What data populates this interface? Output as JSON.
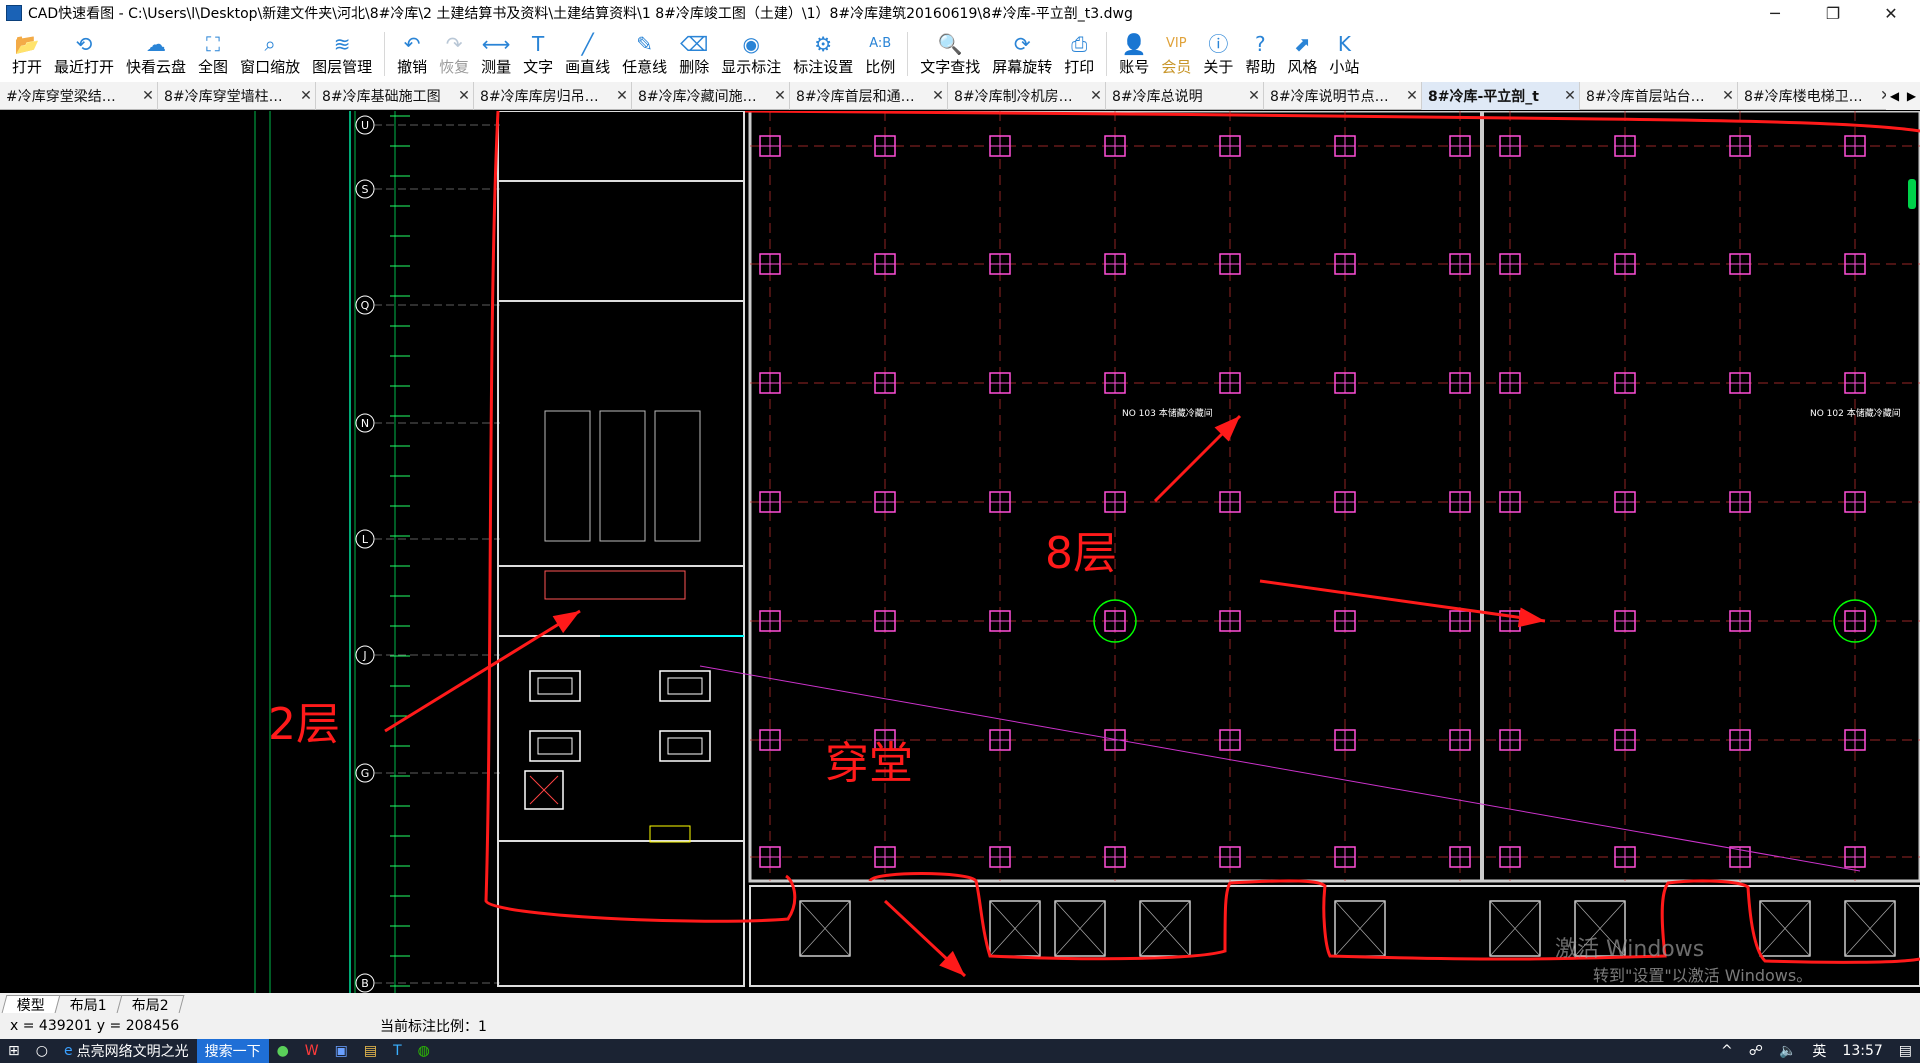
{
  "window": {
    "title": "CAD快速看图 - C:\\Users\\l\\Desktop\\新建文件夹\\河北\\8#冷库\\2  土建结算书及资料\\土建结算资料\\1  8#冷库竣工图（土建）\\1）8#冷库建筑20160619\\8#冷库-平立剖_t3.dwg"
  },
  "toolbar": [
    {
      "label": "打开",
      "icon": "folder-icon",
      "glyph": "📂"
    },
    {
      "label": "最近打开",
      "icon": "history-icon",
      "glyph": "⟲"
    },
    {
      "label": "快看云盘",
      "icon": "cloud-icon",
      "glyph": "☁"
    },
    {
      "label": "全图",
      "icon": "fullview-icon",
      "glyph": "⛶"
    },
    {
      "label": "窗口缩放",
      "icon": "zoom-window-icon",
      "glyph": "⌕"
    },
    {
      "label": "图层管理",
      "icon": "layers-icon",
      "glyph": "≋"
    },
    {
      "label": "撤销",
      "icon": "undo-icon",
      "glyph": "↶"
    },
    {
      "label": "恢复",
      "icon": "redo-icon",
      "glyph": "↷"
    },
    {
      "label": "测量",
      "icon": "measure-icon",
      "glyph": "⟷"
    },
    {
      "label": "文字",
      "icon": "text-icon",
      "glyph": "T"
    },
    {
      "label": "画直线",
      "icon": "line-icon",
      "glyph": "╱"
    },
    {
      "label": "任意线",
      "icon": "pen-icon",
      "glyph": "✎"
    },
    {
      "label": "删除",
      "icon": "eraser-icon",
      "glyph": "⌫"
    },
    {
      "label": "显示标注",
      "icon": "eye-icon",
      "glyph": "◉"
    },
    {
      "label": "标注设置",
      "icon": "settings-icon",
      "glyph": "⚙"
    },
    {
      "label": "比例",
      "icon": "scale-icon",
      "glyph": "A:B"
    },
    {
      "label": "文字查找",
      "icon": "text-search-icon",
      "glyph": "🔍"
    },
    {
      "label": "屏幕旋转",
      "icon": "rotate-icon",
      "glyph": "⟳"
    },
    {
      "label": "打印",
      "icon": "print-icon",
      "glyph": "⎙"
    },
    {
      "label": "账号",
      "icon": "user-icon",
      "glyph": "👤"
    },
    {
      "label": "会员",
      "icon": "vip-icon",
      "glyph": "VIP"
    },
    {
      "label": "关于",
      "icon": "info-icon",
      "glyph": "ⓘ"
    },
    {
      "label": "帮助",
      "icon": "help-icon",
      "glyph": "?"
    },
    {
      "label": "风格",
      "icon": "style-icon",
      "glyph": "⬈"
    },
    {
      "label": "小站",
      "icon": "kstation-icon",
      "glyph": "K"
    }
  ],
  "tabs": [
    {
      "label": "#冷库穿堂梁结…"
    },
    {
      "label": "8#冷库穿堂墙柱…"
    },
    {
      "label": "8#冷库基础施工图"
    },
    {
      "label": "8#冷库库房归吊…"
    },
    {
      "label": "8#冷库冷藏间施…"
    },
    {
      "label": "8#冷库首层和通…"
    },
    {
      "label": "8#冷库制冷机房…"
    },
    {
      "label": "8#冷库总说明"
    },
    {
      "label": "8#冷库说明节点…"
    },
    {
      "label": "8#冷库-平立剖_t"
    },
    {
      "label": "8#冷库首层站台…"
    },
    {
      "label": "8#冷库楼电梯卫…"
    }
  ],
  "active_tab": 9,
  "canvas": {
    "axis_labels": [
      "U",
      "S",
      "Q",
      "N",
      "L",
      "J",
      "G",
      "B"
    ],
    "annotations": {
      "floor8": "8层",
      "floor2": "2层",
      "corridor": "穿堂"
    },
    "room_tags": [
      "NO 103  本储藏冷藏间",
      "NO 102  本储藏冷藏间"
    ],
    "watermark_line1": "激活 Windows",
    "watermark_line2": "转到\"设置\"以激活 Windows。"
  },
  "layout_tabs": [
    "模型",
    "布局1",
    "布局2"
  ],
  "status": {
    "coords": "x = 439201  y = 208456",
    "scale": "当前标注比例：1"
  },
  "taskbar": {
    "browser_item": "点亮网络文明之光",
    "search_item": "搜索一下",
    "ime": "英",
    "clock": "13:57"
  },
  "colors": {
    "accent": "#2a84d6",
    "annotation": "#ff1a1a",
    "grid": "#ff4fd8",
    "axis": "#00d24a"
  }
}
